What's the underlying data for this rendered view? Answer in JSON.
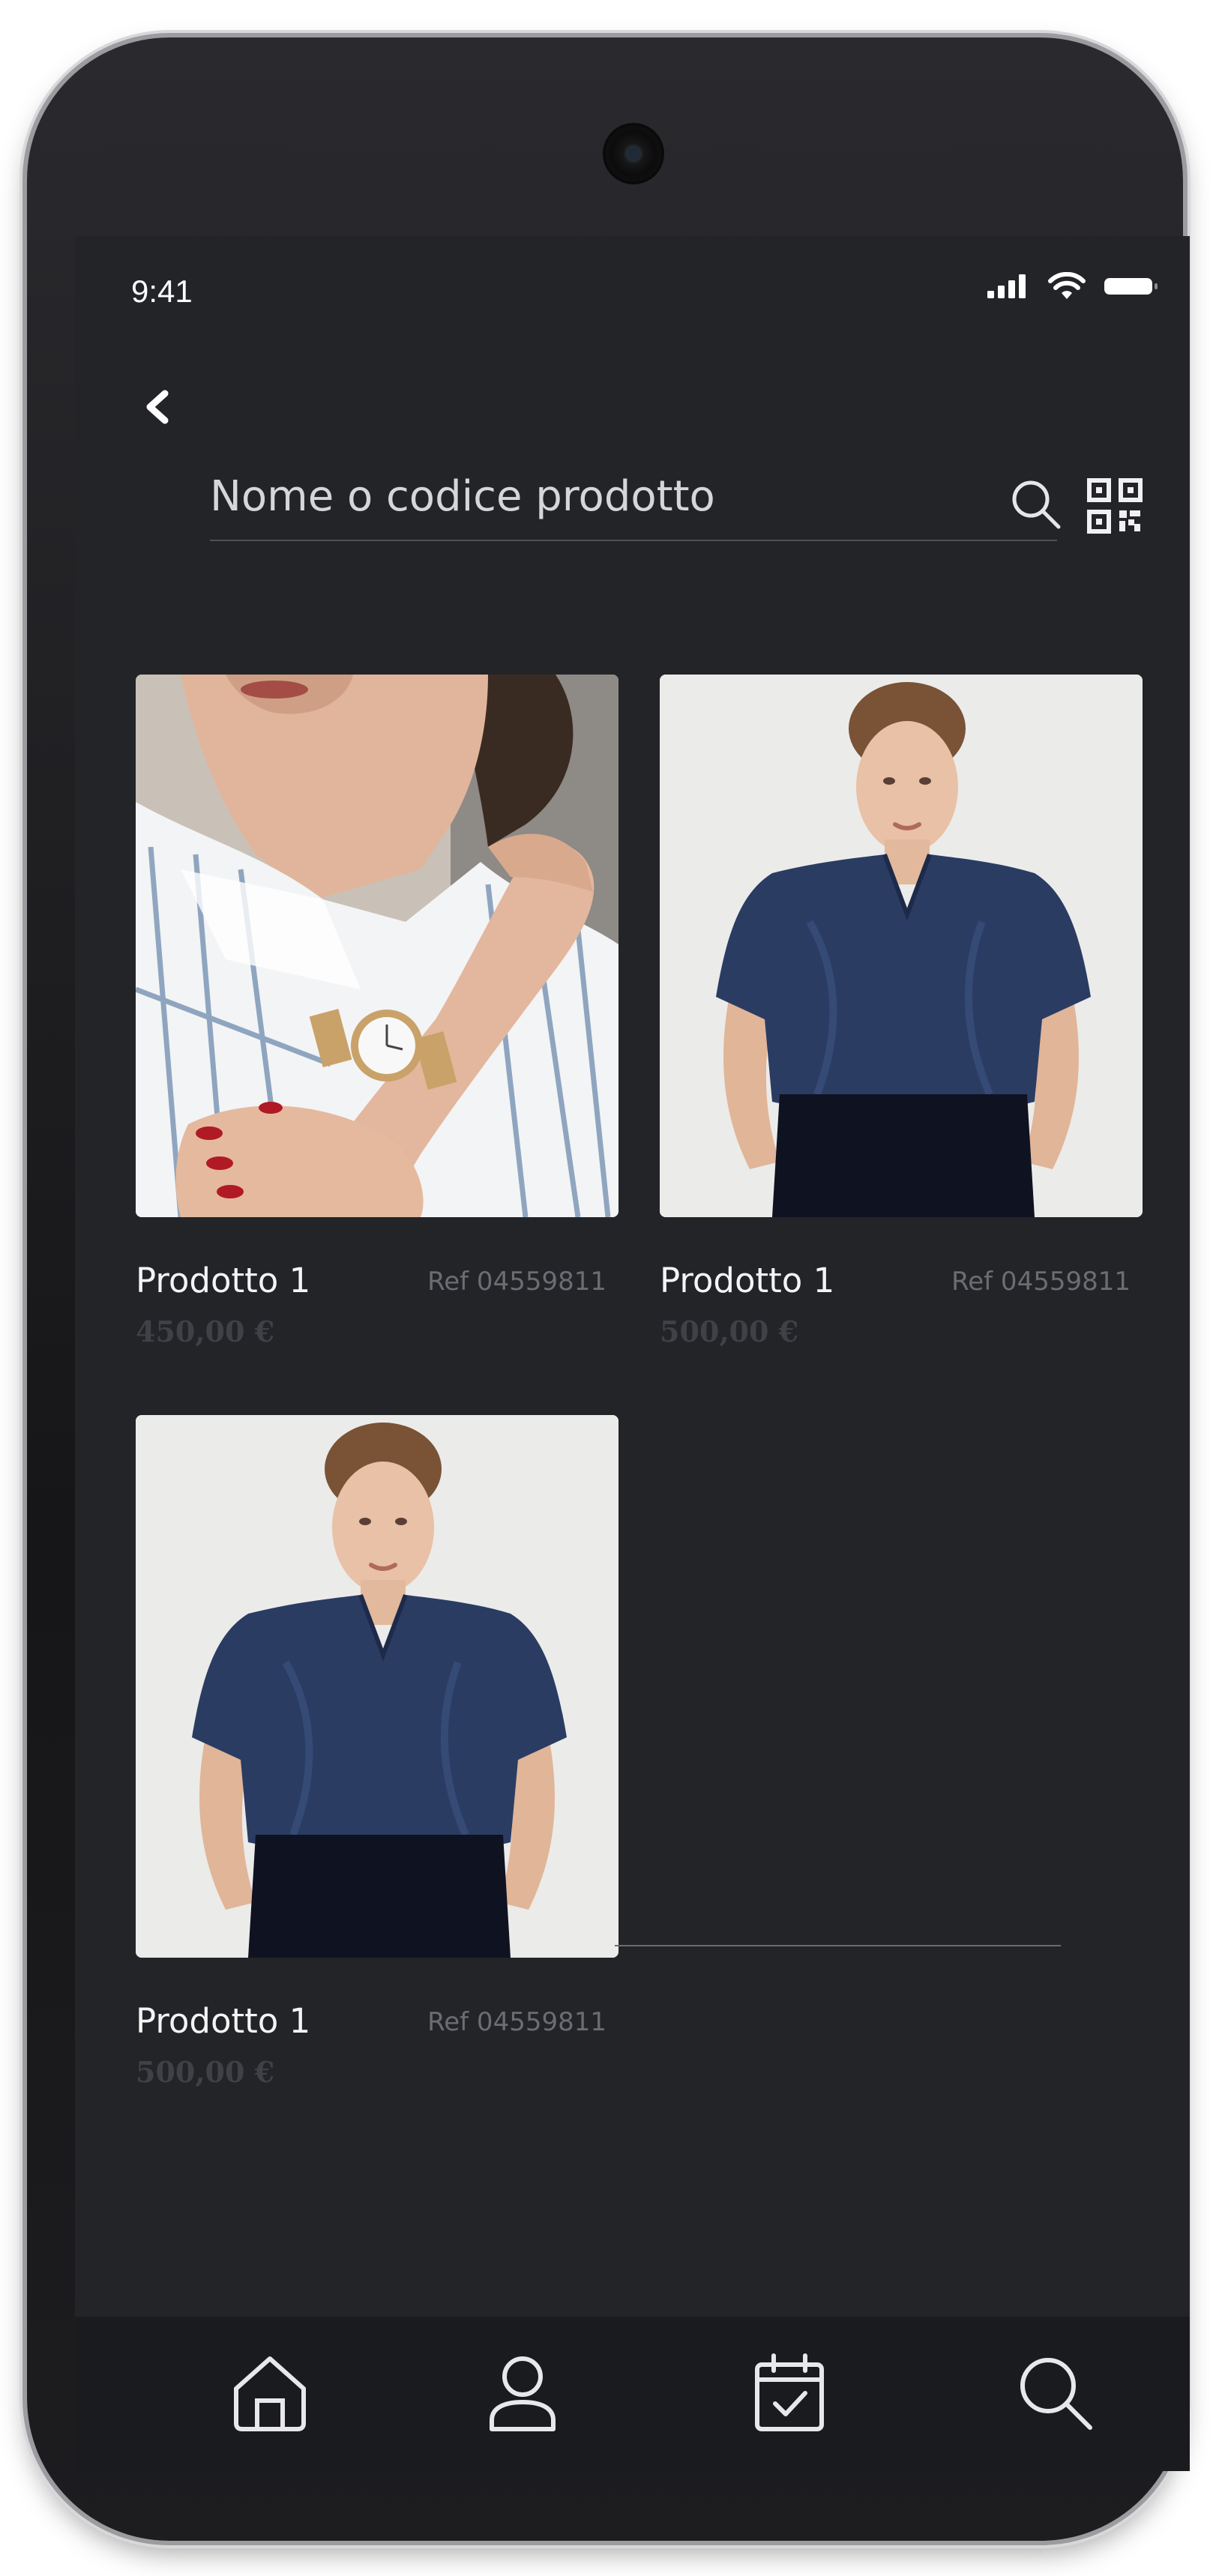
{
  "status_bar": {
    "time": "9:41",
    "icons": [
      "signal-icon",
      "wifi-icon",
      "battery-icon"
    ]
  },
  "header": {
    "back_icon": "chevron-left-icon"
  },
  "search": {
    "placeholder": "Nome o codice prodotto",
    "search_icon": "search-icon",
    "qr_icon": "qr-code-icon"
  },
  "products": [
    {
      "name": "Prodotto 1",
      "ref": "Ref 04559811",
      "price": "450,00 €",
      "image": "woman-wearing-watch-photo"
    },
    {
      "name": "Prodotto 1",
      "ref": "Ref 04559811",
      "price": "500,00 €",
      "image": "woman-navy-blouse-photo"
    },
    {
      "name": "Prodotto 1",
      "ref": "Ref 04559811",
      "price": "500,00 €",
      "image": "woman-navy-blouse-photo"
    }
  ],
  "bottom_nav": {
    "items": [
      "home-icon",
      "user-icon",
      "calendar-check-icon",
      "search-icon"
    ],
    "active": "home-icon"
  },
  "colors": {
    "screen_bg": "#232428",
    "nav_bg": "#1a1b1e",
    "text_primary": "#f4f4f5",
    "text_muted": "#6b6d72",
    "price": "#3f4146"
  }
}
